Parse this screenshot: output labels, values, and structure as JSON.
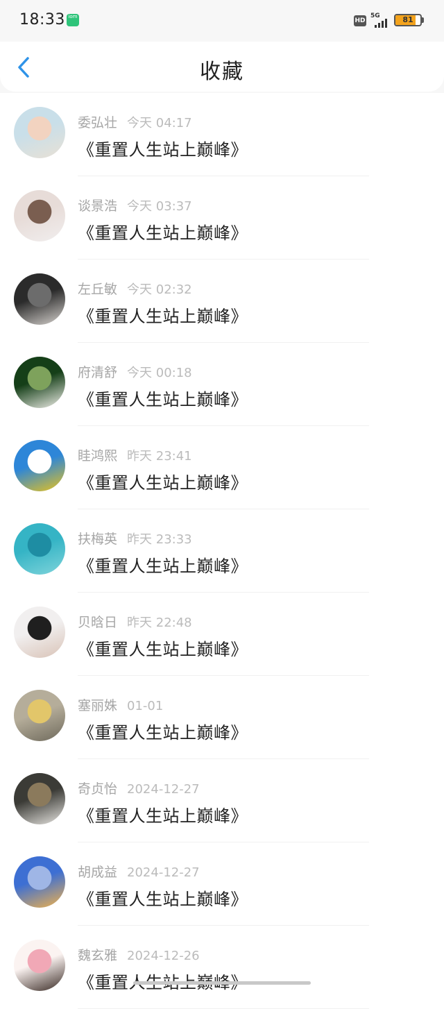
{
  "status_bar": {
    "time": "18:33",
    "app_badge_text": "iom",
    "hd_label": "HD",
    "network_label": "5G",
    "battery_level": 81,
    "battery_text": "81"
  },
  "nav": {
    "title": "收藏",
    "back_icon": "chevron-left-icon",
    "accent": "#2f93e8"
  },
  "favorites": [
    {
      "name": "委弘壮",
      "time": "今天 04:17",
      "title": "《重置人生站上巅峰》",
      "avatar_colors": [
        "#c9dfe9",
        "#f2d3c0",
        "#e8e0d5"
      ]
    },
    {
      "name": "谈景浩",
      "time": "今天 03:37",
      "title": "《重置人生站上巅峰》",
      "avatar_colors": [
        "#e7dcd8",
        "#7a5e50",
        "#f1eeee"
      ]
    },
    {
      "name": "左丘敏",
      "time": "今天 02:32",
      "title": "《重置人生站上巅峰》",
      "avatar_colors": [
        "#2b2b2b",
        "#6c6c6c",
        "#d7d3cf"
      ]
    },
    {
      "name": "府清舒",
      "time": "今天 00:18",
      "title": "《重置人生站上巅峰》",
      "avatar_colors": [
        "#153f18",
        "#7ea25c",
        "#f1f0ea"
      ]
    },
    {
      "name": "眭鸿熙",
      "time": "昨天 23:41",
      "title": "《重置人生站上巅峰》",
      "avatar_colors": [
        "#2d86d8",
        "#ffffff",
        "#e9c21c"
      ]
    },
    {
      "name": "扶梅英",
      "time": "昨天 23:33",
      "title": "《重置人生站上巅峰》",
      "avatar_colors": [
        "#35b4c5",
        "#1e8da3",
        "#7fd4db"
      ]
    },
    {
      "name": "贝晗日",
      "time": "昨天 22:48",
      "title": "《重置人生站上巅峰》",
      "avatar_colors": [
        "#f1efef",
        "#1f1f1f",
        "#d9c3b7"
      ]
    },
    {
      "name": "塞丽姝",
      "time": "01-01",
      "title": "《重置人生站上巅峰》",
      "avatar_colors": [
        "#b5ad9a",
        "#e2c66a",
        "#6f6a5c"
      ]
    },
    {
      "name": "奇贞怡",
      "time": "2024-12-27",
      "title": "《重置人生站上巅峰》",
      "avatar_colors": [
        "#3b3b36",
        "#8b7a5c",
        "#e8e6e2"
      ]
    },
    {
      "name": "胡成益",
      "time": "2024-12-27",
      "title": "《重置人生站上巅峰》",
      "avatar_colors": [
        "#3d6fd3",
        "#9fb6e6",
        "#f2b24a"
      ]
    },
    {
      "name": "魏玄雅",
      "time": "2024-12-26",
      "title": "《重置人生站上巅峰》",
      "avatar_colors": [
        "#fbf3f1",
        "#f1a8b6",
        "#3a2b25"
      ]
    }
  ]
}
